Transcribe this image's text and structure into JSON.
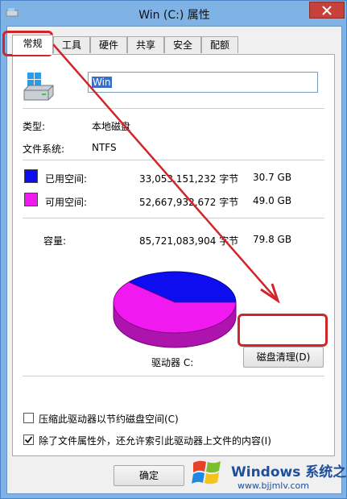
{
  "window": {
    "title": "Win (C:) 属性"
  },
  "tabs": [
    {
      "label": "常规"
    },
    {
      "label": "工具"
    },
    {
      "label": "硬件"
    },
    {
      "label": "共享"
    },
    {
      "label": "安全"
    },
    {
      "label": "配额"
    }
  ],
  "drive": {
    "name_value": "Win"
  },
  "info": {
    "type_label": "类型:",
    "type_value": "本地磁盘",
    "fs_label": "文件系统:",
    "fs_value": "NTFS"
  },
  "space": {
    "used_label": "已用空间:",
    "used_bytes": "33,053,151,232 字节",
    "used_gb": "30.7 GB",
    "free_label": "可用空间:",
    "free_bytes": "52,667,932,672 字节",
    "free_gb": "49.0 GB",
    "capacity_label": "容量:",
    "capacity_bytes": "85,721,083,904 字节",
    "capacity_gb": "79.8 GB",
    "used_color": "#0d0df0",
    "free_color": "#f01af0"
  },
  "chart_data": {
    "type": "pie",
    "categories": [
      "已用空间",
      "可用空间"
    ],
    "values": [
      30.7,
      49.0
    ],
    "colors": [
      "#0d0df0",
      "#f01af0"
    ]
  },
  "drive_label": "驱动器 C:",
  "cleanup_button": "磁盘清理(D)",
  "options": {
    "compress_label": "压缩此驱动器以节约磁盘空间(C)",
    "compress_checked": false,
    "index_label": "除了文件属性外，还允许索引此驱动器上文件的内容(I)",
    "index_checked": true
  },
  "ok_button": "确定",
  "watermark": {
    "title": "Windows 系统之家",
    "url": "www.bjjmlv.com"
  }
}
